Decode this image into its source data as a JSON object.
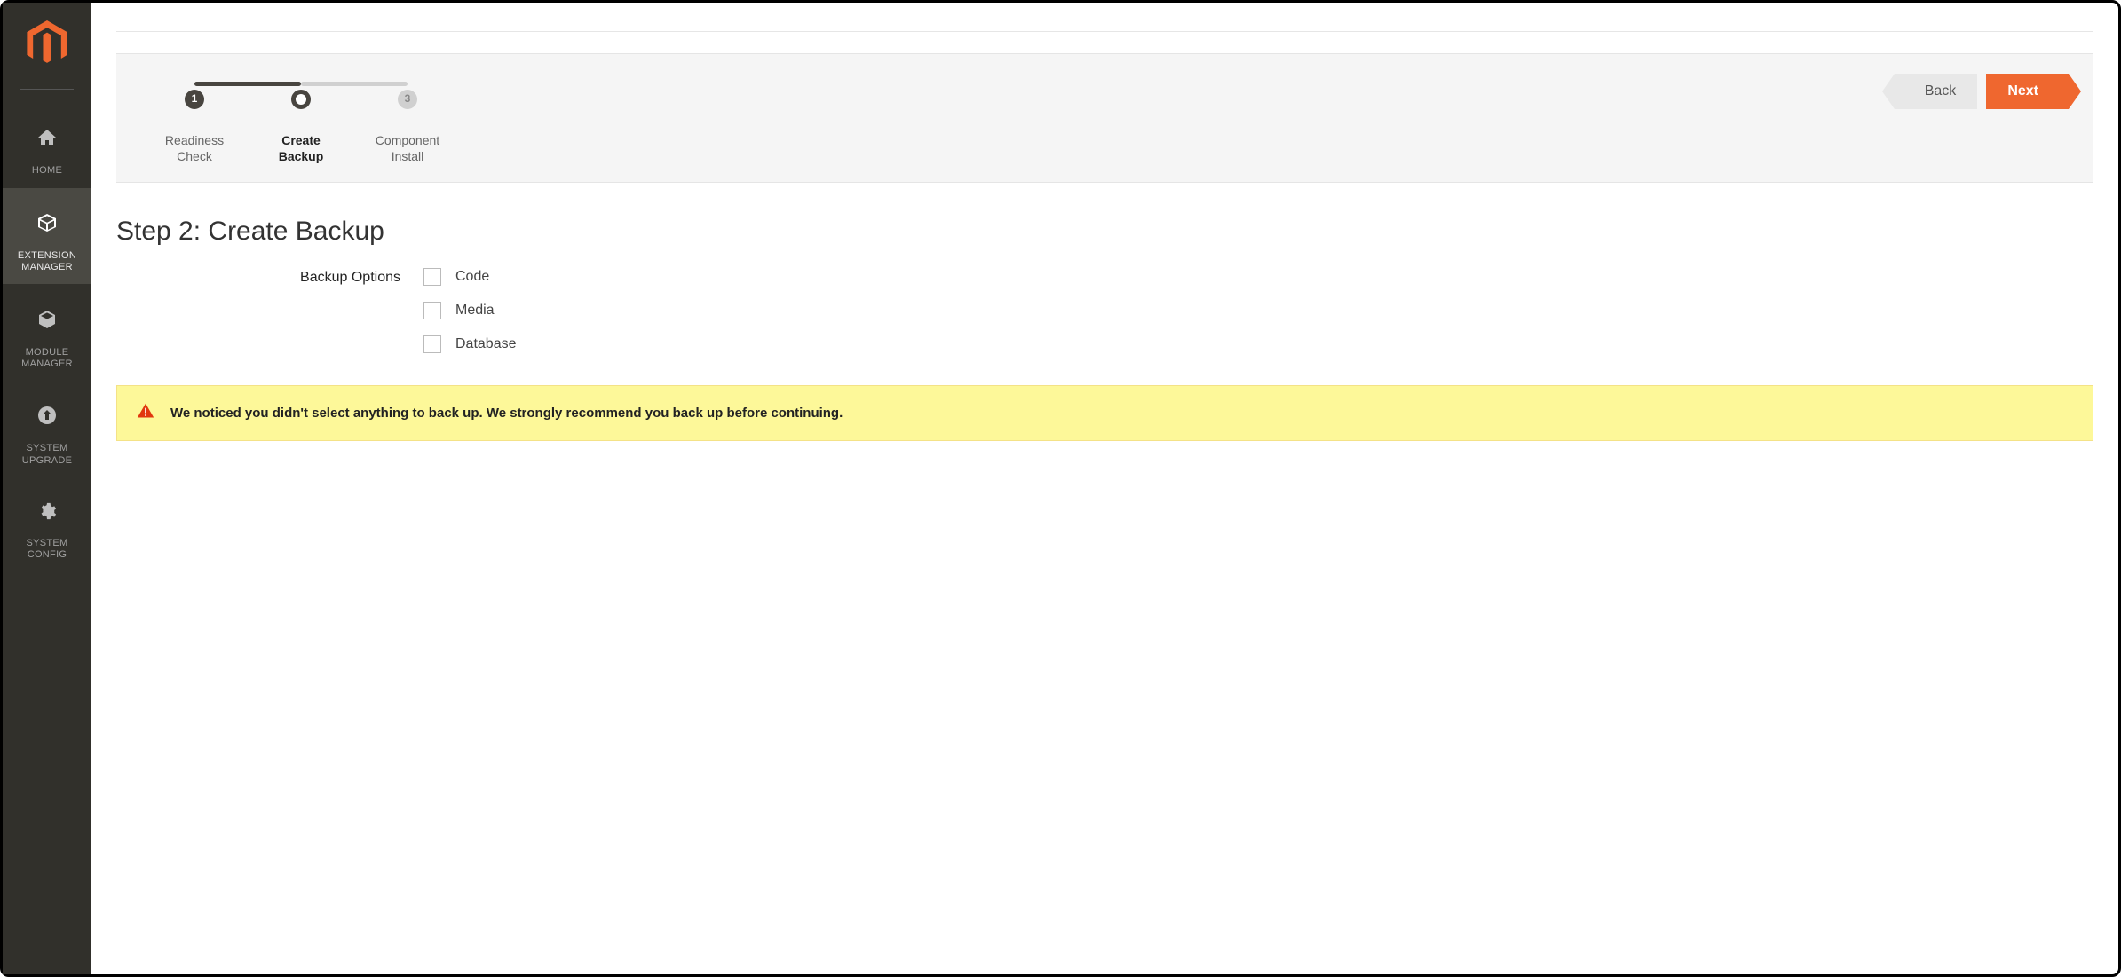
{
  "sidebar": {
    "items": [
      {
        "label": "HOME"
      },
      {
        "label": "EXTENSION\nMANAGER"
      },
      {
        "label": "MODULE\nMANAGER"
      },
      {
        "label": "SYSTEM\nUPGRADE"
      },
      {
        "label": "SYSTEM\nCONFIG"
      }
    ]
  },
  "wizard": {
    "steps": [
      {
        "num": "1",
        "label": "Readiness\nCheck"
      },
      {
        "num": "",
        "label": "Create\nBackup"
      },
      {
        "num": "3",
        "label": "Component\nInstall"
      }
    ],
    "back": "Back",
    "next": "Next"
  },
  "page": {
    "title": "Step 2: Create Backup",
    "options_label": "Backup Options",
    "options": [
      {
        "label": "Code"
      },
      {
        "label": "Media"
      },
      {
        "label": "Database"
      }
    ]
  },
  "alert": {
    "text": "We noticed you didn't select anything to back up. We strongly recommend you back up before continuing."
  },
  "colors": {
    "accent": "#ef672f",
    "alert_bg": "#fdf899"
  }
}
